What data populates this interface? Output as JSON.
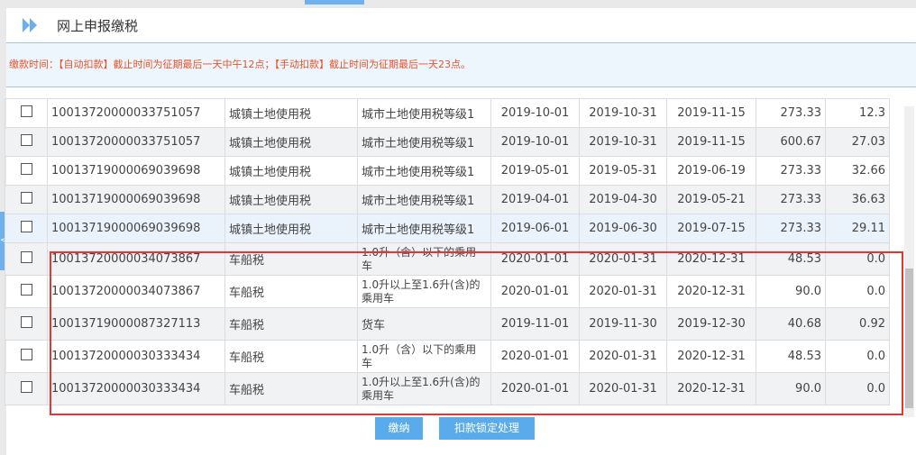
{
  "header": {
    "title": "网上申报缴税"
  },
  "notice": "缴款时间：【自动扣款】截止时间为征期最后一天中午12点；【手动扣款】截止时间为征期最后一天23点。",
  "rows": [
    [
      "10013720000033751057",
      "城镇土地使用税",
      "城市土地使用税等级1",
      "2019-10-01",
      "2019-10-31",
      "2019-11-15",
      "273.33",
      "12.3"
    ],
    [
      "10013720000033751057",
      "城镇土地使用税",
      "城市土地使用税等级1",
      "2019-10-01",
      "2019-10-31",
      "2019-11-15",
      "600.67",
      "27.03"
    ],
    [
      "10013719000069039698",
      "城镇土地使用税",
      "城市土地使用税等级1",
      "2019-05-01",
      "2019-05-31",
      "2019-06-19",
      "273.33",
      "32.66"
    ],
    [
      "10013719000069039698",
      "城镇土地使用税",
      "城市土地使用税等级1",
      "2019-04-01",
      "2019-04-30",
      "2019-05-21",
      "273.33",
      "36.63"
    ],
    [
      "10013719000069039698",
      "城镇土地使用税",
      "城市土地使用税等级1",
      "2019-06-01",
      "2019-06-30",
      "2019-07-15",
      "273.33",
      "29.11"
    ],
    [
      "10013720000034073867",
      "车船税",
      "1.0升（含）以下的乘用车",
      "2020-01-01",
      "2020-01-31",
      "2020-12-31",
      "48.53",
      "0.0"
    ],
    [
      "10013720000034073867",
      "车船税",
      "1.0升以上至1.6升(含)的乘用车",
      "2020-01-01",
      "2020-01-31",
      "2020-12-31",
      "90.0",
      "0.0"
    ],
    [
      "10013719000087327113",
      "车船税",
      "货车",
      "2019-11-01",
      "2019-11-30",
      "2019-12-30",
      "40.68",
      "0.92"
    ],
    [
      "10013720000030333434",
      "车船税",
      "1.0升（含）以下的乘用车",
      "2020-01-01",
      "2020-01-31",
      "2020-12-31",
      "48.53",
      "0.0"
    ],
    [
      "10013720000030333434",
      "车船税",
      "1.0升以上至1.6升(含)的乘用车",
      "2020-01-01",
      "2020-01-31",
      "2020-12-31",
      "90.0",
      "0.0"
    ]
  ],
  "buttons": {
    "pay": "缴纳",
    "lock": "扣款锁定处理"
  },
  "side_tab": "<"
}
